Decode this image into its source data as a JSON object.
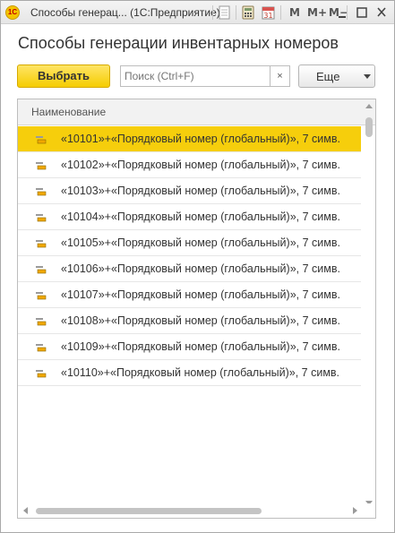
{
  "titlebar": {
    "logo_text": "1С",
    "title": "Способы генерац...  (1С:Предприятие)",
    "m_label": "M",
    "m_plus_label": "M+",
    "m_minus_label": "M−",
    "icons": [
      "document-icon",
      "calculator-icon",
      "calendar-icon",
      "minimize-icon",
      "maximize-icon",
      "close-icon"
    ],
    "calendar_day": "31"
  },
  "form": {
    "title": "Способы генерации инвентарных номеров",
    "select_button": "Выбрать",
    "search_placeholder": "Поиск (Ctrl+F)",
    "search_clear": "×",
    "more_button": "Еще"
  },
  "table": {
    "column_header": "Наименование",
    "rows": [
      "«10101»+«Порядковый номер (глобальный)», 7 симв.",
      "«10102»+«Порядковый номер (глобальный)», 7 симв.",
      "«10103»+«Порядковый номер (глобальный)», 7 симв.",
      "«10104»+«Порядковый номер (глобальный)», 7 симв.",
      "«10105»+«Порядковый номер (глобальный)», 7 симв.",
      "«10106»+«Порядковый номер (глобальный)», 7 симв.",
      "«10107»+«Порядковый номер (глобальный)», 7 симв.",
      "«10108»+«Порядковый номер (глобальный)», 7 симв.",
      "«10109»+«Порядковый номер (глобальный)», 7 симв.",
      "«10110»+«Порядковый номер (глобальный)», 7 симв."
    ],
    "selected_row": 0,
    "row_icon": "catalog-item-icon"
  },
  "colors": {
    "accent": "#f6ce0c",
    "select_button": "#f5cd00"
  }
}
